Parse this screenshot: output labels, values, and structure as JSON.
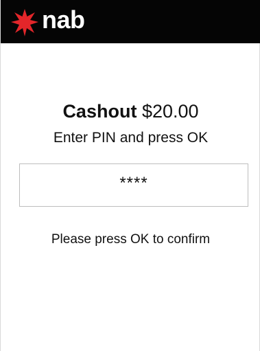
{
  "header": {
    "brand_name": "nab",
    "logo_icon": "nab-star-icon",
    "background_color": "#050505",
    "logo_color": "#e3262a",
    "text_color": "#ffffff"
  },
  "transaction": {
    "title_label": "Cashout",
    "amount": "$20.00",
    "prompt": "Enter PIN and press OK"
  },
  "pin_entry": {
    "value": "****"
  },
  "confirmation": {
    "message": "Please press OK to confirm"
  }
}
